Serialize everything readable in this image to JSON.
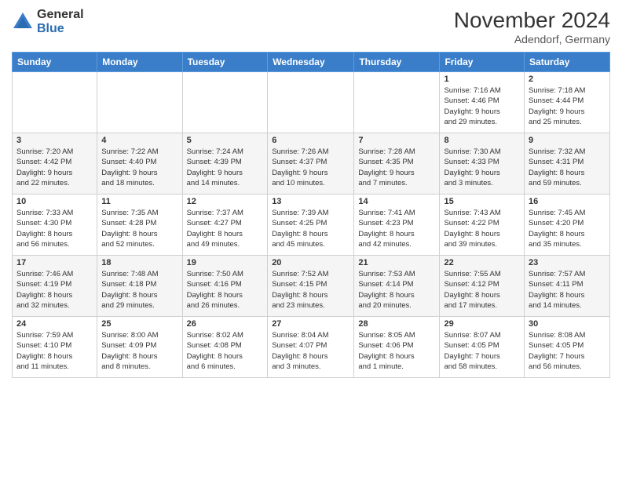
{
  "logo": {
    "general": "General",
    "blue": "Blue"
  },
  "title": "November 2024",
  "location": "Adendorf, Germany",
  "headers": [
    "Sunday",
    "Monday",
    "Tuesday",
    "Wednesday",
    "Thursday",
    "Friday",
    "Saturday"
  ],
  "weeks": [
    [
      {
        "day": "",
        "info": ""
      },
      {
        "day": "",
        "info": ""
      },
      {
        "day": "",
        "info": ""
      },
      {
        "day": "",
        "info": ""
      },
      {
        "day": "",
        "info": ""
      },
      {
        "day": "1",
        "info": "Sunrise: 7:16 AM\nSunset: 4:46 PM\nDaylight: 9 hours\nand 29 minutes."
      },
      {
        "day": "2",
        "info": "Sunrise: 7:18 AM\nSunset: 4:44 PM\nDaylight: 9 hours\nand 25 minutes."
      }
    ],
    [
      {
        "day": "3",
        "info": "Sunrise: 7:20 AM\nSunset: 4:42 PM\nDaylight: 9 hours\nand 22 minutes."
      },
      {
        "day": "4",
        "info": "Sunrise: 7:22 AM\nSunset: 4:40 PM\nDaylight: 9 hours\nand 18 minutes."
      },
      {
        "day": "5",
        "info": "Sunrise: 7:24 AM\nSunset: 4:39 PM\nDaylight: 9 hours\nand 14 minutes."
      },
      {
        "day": "6",
        "info": "Sunrise: 7:26 AM\nSunset: 4:37 PM\nDaylight: 9 hours\nand 10 minutes."
      },
      {
        "day": "7",
        "info": "Sunrise: 7:28 AM\nSunset: 4:35 PM\nDaylight: 9 hours\nand 7 minutes."
      },
      {
        "day": "8",
        "info": "Sunrise: 7:30 AM\nSunset: 4:33 PM\nDaylight: 9 hours\nand 3 minutes."
      },
      {
        "day": "9",
        "info": "Sunrise: 7:32 AM\nSunset: 4:31 PM\nDaylight: 8 hours\nand 59 minutes."
      }
    ],
    [
      {
        "day": "10",
        "info": "Sunrise: 7:33 AM\nSunset: 4:30 PM\nDaylight: 8 hours\nand 56 minutes."
      },
      {
        "day": "11",
        "info": "Sunrise: 7:35 AM\nSunset: 4:28 PM\nDaylight: 8 hours\nand 52 minutes."
      },
      {
        "day": "12",
        "info": "Sunrise: 7:37 AM\nSunset: 4:27 PM\nDaylight: 8 hours\nand 49 minutes."
      },
      {
        "day": "13",
        "info": "Sunrise: 7:39 AM\nSunset: 4:25 PM\nDaylight: 8 hours\nand 45 minutes."
      },
      {
        "day": "14",
        "info": "Sunrise: 7:41 AM\nSunset: 4:23 PM\nDaylight: 8 hours\nand 42 minutes."
      },
      {
        "day": "15",
        "info": "Sunrise: 7:43 AM\nSunset: 4:22 PM\nDaylight: 8 hours\nand 39 minutes."
      },
      {
        "day": "16",
        "info": "Sunrise: 7:45 AM\nSunset: 4:20 PM\nDaylight: 8 hours\nand 35 minutes."
      }
    ],
    [
      {
        "day": "17",
        "info": "Sunrise: 7:46 AM\nSunset: 4:19 PM\nDaylight: 8 hours\nand 32 minutes."
      },
      {
        "day": "18",
        "info": "Sunrise: 7:48 AM\nSunset: 4:18 PM\nDaylight: 8 hours\nand 29 minutes."
      },
      {
        "day": "19",
        "info": "Sunrise: 7:50 AM\nSunset: 4:16 PM\nDaylight: 8 hours\nand 26 minutes."
      },
      {
        "day": "20",
        "info": "Sunrise: 7:52 AM\nSunset: 4:15 PM\nDaylight: 8 hours\nand 23 minutes."
      },
      {
        "day": "21",
        "info": "Sunrise: 7:53 AM\nSunset: 4:14 PM\nDaylight: 8 hours\nand 20 minutes."
      },
      {
        "day": "22",
        "info": "Sunrise: 7:55 AM\nSunset: 4:12 PM\nDaylight: 8 hours\nand 17 minutes."
      },
      {
        "day": "23",
        "info": "Sunrise: 7:57 AM\nSunset: 4:11 PM\nDaylight: 8 hours\nand 14 minutes."
      }
    ],
    [
      {
        "day": "24",
        "info": "Sunrise: 7:59 AM\nSunset: 4:10 PM\nDaylight: 8 hours\nand 11 minutes."
      },
      {
        "day": "25",
        "info": "Sunrise: 8:00 AM\nSunset: 4:09 PM\nDaylight: 8 hours\nand 8 minutes."
      },
      {
        "day": "26",
        "info": "Sunrise: 8:02 AM\nSunset: 4:08 PM\nDaylight: 8 hours\nand 6 minutes."
      },
      {
        "day": "27",
        "info": "Sunrise: 8:04 AM\nSunset: 4:07 PM\nDaylight: 8 hours\nand 3 minutes."
      },
      {
        "day": "28",
        "info": "Sunrise: 8:05 AM\nSunset: 4:06 PM\nDaylight: 8 hours\nand 1 minute."
      },
      {
        "day": "29",
        "info": "Sunrise: 8:07 AM\nSunset: 4:05 PM\nDaylight: 7 hours\nand 58 minutes."
      },
      {
        "day": "30",
        "info": "Sunrise: 8:08 AM\nSunset: 4:05 PM\nDaylight: 7 hours\nand 56 minutes."
      }
    ]
  ]
}
